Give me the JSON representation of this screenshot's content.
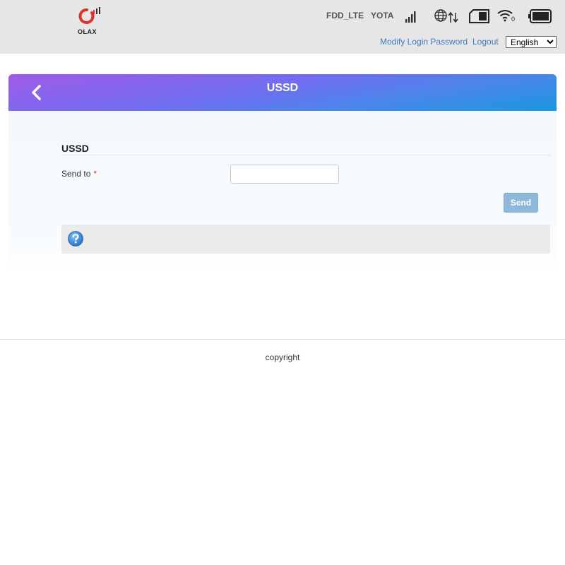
{
  "header": {
    "logo_text": "OLAX",
    "network_type": "FDD_LTE",
    "operator": "YOTA",
    "wifi_clients": "0",
    "links": {
      "modify_password": "Modify Login Password",
      "logout": "Logout"
    },
    "language": {
      "selected": "English",
      "options": [
        "English"
      ]
    },
    "icons": [
      "signal-bars-icon",
      "globe-data-icon",
      "sim-card-icon",
      "wifi-icon",
      "battery-icon"
    ]
  },
  "card": {
    "title": "USSD",
    "back_icon": "chevron-left-icon",
    "section_title": "USSD",
    "send_to_label": "Send to",
    "required_mark": "*",
    "send_to_value": "",
    "send_button": "Send",
    "help_icon": "question-circle-icon"
  },
  "colors": {
    "header_bg": "#e6e6e6",
    "link": "#3a7bbf",
    "gradient_start": "#a05be8",
    "gradient_end": "#1a97e0",
    "send_button": "#8db8dc",
    "logo_red": "#e0302a"
  },
  "footer": {
    "copyright": "copyright"
  }
}
